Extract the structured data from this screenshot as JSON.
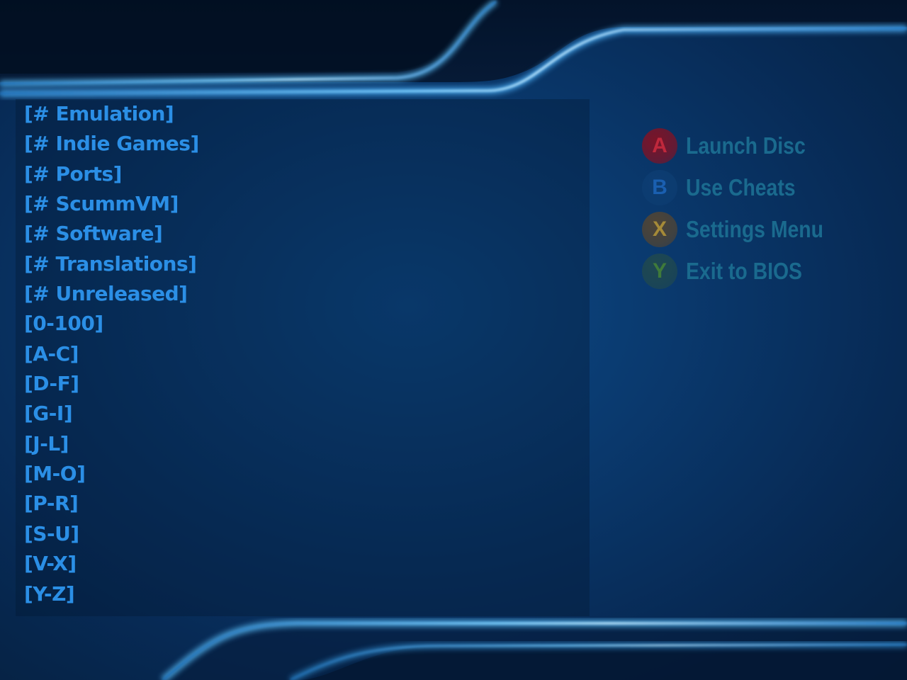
{
  "folders": [
    "[# Emulation]",
    "[# Indie Games]",
    "[# Ports]",
    "[# ScummVM]",
    "[# Software]",
    "[# Translations]",
    "[# Unreleased]",
    "[0-100]",
    "[A-C]",
    "[D-F]",
    "[G-I]",
    "[J-L]",
    "[M-O]",
    "[P-R]",
    "[S-U]",
    "[V-X]",
    "[Y-Z]"
  ],
  "legend": [
    {
      "button": "A",
      "label": "Launch Disc",
      "color": "#7a1428",
      "text_color": "#c0283c"
    },
    {
      "button": "B",
      "label": "Use Cheats",
      "color": "#0d3d72",
      "text_color": "#1a5fb0"
    },
    {
      "button": "X",
      "label": "Settings Menu",
      "color": "#4e4436",
      "text_color": "#a58a38"
    },
    {
      "button": "Y",
      "label": "Exit to BIOS",
      "color": "#1f4850",
      "text_color": "#3f7a3a"
    }
  ],
  "colors": {
    "list_text": "#2b8fe6",
    "legend_text": "#1a6a8e",
    "background": "#0a3a6f",
    "accent_glow": "#5cc2ff"
  }
}
